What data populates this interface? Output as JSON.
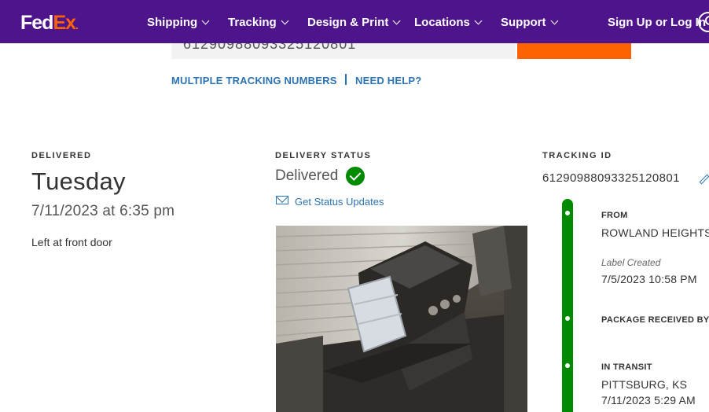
{
  "header": {
    "logo": {
      "fed": "Fed",
      "ex": "Ex",
      "dot": "."
    },
    "nav": [
      {
        "label": "Shipping"
      },
      {
        "label": "Tracking"
      },
      {
        "label": "Design & Print"
      },
      {
        "label": "Locations"
      },
      {
        "label": "Support"
      }
    ],
    "sign_in": "Sign Up or Log In",
    "colors": {
      "purple": "#4d148c",
      "orange": "#ff6200"
    }
  },
  "search": {
    "value": "612909880933251208​01"
  },
  "links": {
    "multiple": "MULTIPLE TRACKING NUMBERS",
    "help": "NEED HELP?"
  },
  "delivered": {
    "label": "DELIVERED",
    "day": "Tuesday",
    "datetime": "7/11/2023 at 6:35 pm",
    "note": "Left at front door"
  },
  "delivery_status": {
    "label": "DELIVERY STATUS",
    "status": "Delivered",
    "updates_link": "Get Status Updates",
    "status_color": "#008a00"
  },
  "tracking": {
    "label": "TRACKING ID",
    "id": "612909880933251208​01"
  },
  "timeline": {
    "from_label": "FROM",
    "from_value": "ROWLAND HEIGHTS",
    "label_created": "Label Created",
    "label_created_time": "7/5/2023 10:58 PM",
    "received_label": "PACKAGE RECEIVED BY",
    "transit_label": "IN TRANSIT",
    "transit_location": "PITTSBURG, KS",
    "transit_time": "7/11/2023 5:29 AM"
  }
}
